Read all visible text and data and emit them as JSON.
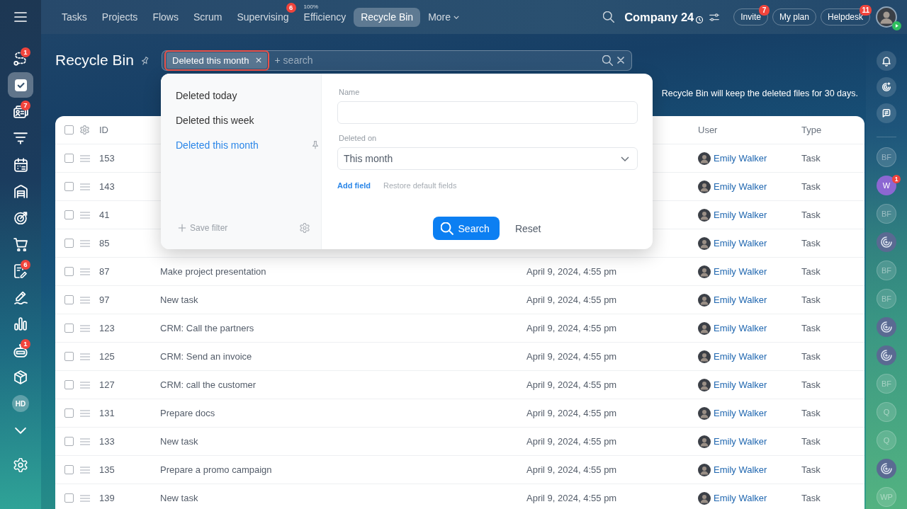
{
  "topbar": {
    "nav": [
      {
        "label": "Tasks",
        "selected": false
      },
      {
        "label": "Projects",
        "selected": false
      },
      {
        "label": "Flows",
        "selected": false
      },
      {
        "label": "Scrum",
        "selected": false
      },
      {
        "label": "Supervising",
        "selected": false,
        "badge": "6"
      },
      {
        "label": "Efficiency",
        "selected": false,
        "caption": "100%"
      },
      {
        "label": "Recycle Bin",
        "selected": true
      },
      {
        "label": "More",
        "selected": false,
        "kind": "dropdown"
      }
    ],
    "company": "Company 24",
    "buttons": [
      {
        "label": "Invite",
        "badge": "7"
      },
      {
        "label": "My plan"
      },
      {
        "label": "Helpdesk",
        "badge": "11"
      }
    ]
  },
  "sidebar": {
    "items": [
      {
        "kind": "icon",
        "selected": false,
        "badge": "1"
      },
      {
        "kind": "icon",
        "selected": true
      },
      {
        "kind": "icon",
        "selected": false,
        "badge": "7"
      },
      {
        "kind": "icon",
        "selected": false
      },
      {
        "kind": "icon",
        "selected": false
      },
      {
        "kind": "icon",
        "selected": false
      },
      {
        "kind": "icon",
        "selected": false
      },
      {
        "kind": "icon",
        "selected": false
      },
      {
        "kind": "icon",
        "selected": false,
        "badge": "6"
      },
      {
        "kind": "icon",
        "selected": false
      },
      {
        "kind": "icon",
        "selected": false
      },
      {
        "kind": "icon",
        "selected": false,
        "badge": "1"
      },
      {
        "kind": "icon",
        "selected": false
      },
      {
        "kind": "initials",
        "selected": false,
        "label": "HD"
      }
    ]
  },
  "page": {
    "title": "Recycle Bin",
    "info": "Recycle Bin will keep the deleted files for 30 days."
  },
  "filter_bar": {
    "chip": {
      "label": "Deleted this month",
      "highlighted": true
    },
    "add_symbol": "+",
    "placeholder": "search"
  },
  "filter_popup": {
    "presets": [
      {
        "label": "Deleted today",
        "selected": false,
        "pinned": false
      },
      {
        "label": "Deleted this week",
        "selected": false,
        "pinned": false
      },
      {
        "label": "Deleted this month",
        "selected": true,
        "pinned": true
      }
    ],
    "save_filter": "Save filter",
    "fields": [
      {
        "kind": "text",
        "label": "Name"
      },
      {
        "kind": "select",
        "label": "Deleted on",
        "value": "This month"
      }
    ],
    "add_field": "Add field",
    "restore_fields": "Restore default fields",
    "search_button": "Search",
    "reset_button": "Reset"
  },
  "table": {
    "all_checked": false,
    "columns": {
      "id": "ID",
      "user": "User",
      "type": "Type"
    },
    "rows": [
      {
        "id": "153",
        "user": "Emily Walker",
        "type": "Task",
        "checked": false
      },
      {
        "id": "143",
        "user": "Emily Walker",
        "type": "Task",
        "checked": false
      },
      {
        "id": "41",
        "user": "Emily Walker",
        "type": "Task",
        "checked": false
      },
      {
        "id": "85",
        "user": "Emily Walker",
        "type": "Task",
        "checked": false
      },
      {
        "id": "87",
        "name": "Make project presentation",
        "date": "April 9, 2024, 4:55 pm",
        "user": "Emily Walker",
        "type": "Task",
        "checked": false
      },
      {
        "id": "97",
        "name": "New task",
        "date": "April 9, 2024, 4:55 pm",
        "user": "Emily Walker",
        "type": "Task",
        "checked": false
      },
      {
        "id": "123",
        "name": "CRM: Call the partners",
        "date": "April 9, 2024, 4:55 pm",
        "user": "Emily Walker",
        "type": "Task",
        "checked": false
      },
      {
        "id": "125",
        "name": "CRM: Send an invoice",
        "date": "April 9, 2024, 4:55 pm",
        "user": "Emily Walker",
        "type": "Task",
        "checked": false
      },
      {
        "id": "127",
        "name": "CRM: call the customer",
        "date": "April 9, 2024, 4:55 pm",
        "user": "Emily Walker",
        "type": "Task",
        "checked": false
      },
      {
        "id": "131",
        "name": "Prepare docs",
        "date": "April 9, 2024, 4:55 pm",
        "user": "Emily Walker",
        "type": "Task",
        "checked": false
      },
      {
        "id": "133",
        "name": "New task",
        "date": "April 9, 2024, 4:55 pm",
        "user": "Emily Walker",
        "type": "Task",
        "checked": false
      },
      {
        "id": "135",
        "name": "Prepare a promo campaign",
        "date": "April 9, 2024, 4:55 pm",
        "user": "Emily Walker",
        "type": "Task",
        "checked": false
      },
      {
        "id": "139",
        "name": "New task",
        "date": "April 9, 2024, 4:55 pm",
        "user": "Emily Walker",
        "type": "Task",
        "checked": false
      }
    ]
  },
  "rightbar": {
    "chats": [
      {
        "kind": "initials",
        "initials": "BF",
        "dimmed": true
      },
      {
        "kind": "initials",
        "initials": "W",
        "dimmed": false,
        "badge": "1"
      },
      {
        "kind": "initials",
        "initials": "BF",
        "dimmed": true
      },
      {
        "kind": "icon"
      },
      {
        "kind": "initials",
        "initials": "BF",
        "dimmed": true
      },
      {
        "kind": "initials",
        "initials": "BF",
        "dimmed": true
      },
      {
        "kind": "icon"
      },
      {
        "kind": "icon"
      },
      {
        "kind": "initials",
        "initials": "BF",
        "dimmed": true
      },
      {
        "kind": "initials",
        "initials": "Q",
        "dimmed": true
      },
      {
        "kind": "initials",
        "initials": "Q",
        "dimmed": true
      },
      {
        "kind": "icon"
      },
      {
        "kind": "initials",
        "initials": "WP",
        "dimmed": true
      }
    ]
  }
}
